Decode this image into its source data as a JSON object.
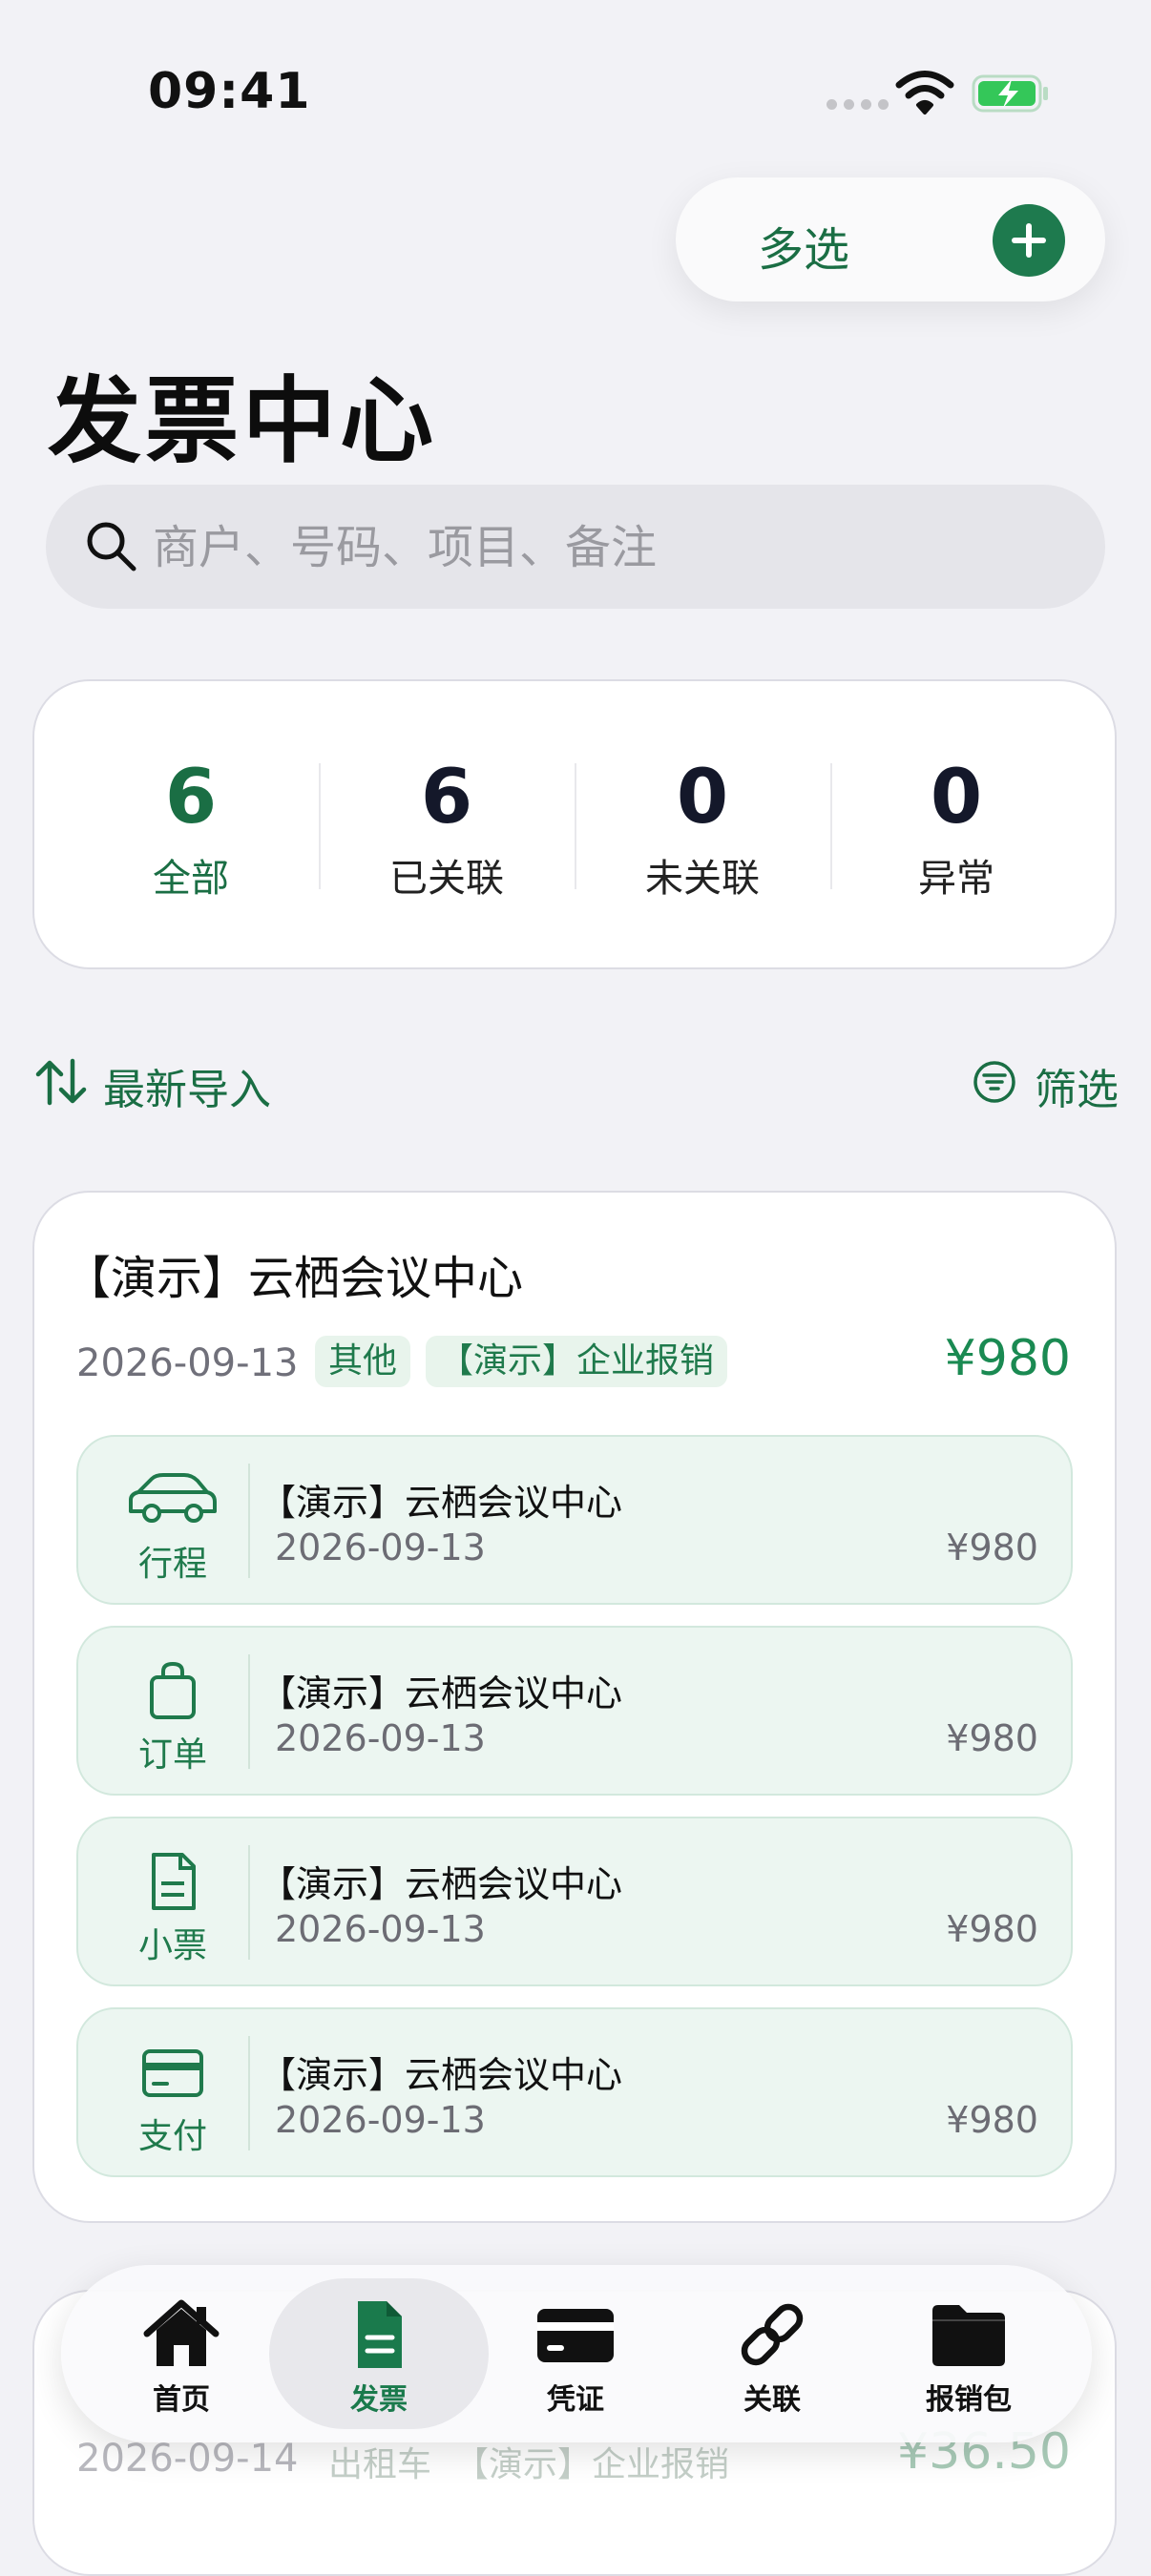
{
  "status_bar": {
    "time": "09:41"
  },
  "header": {
    "multi_select_label": "多选",
    "title": "发票中心"
  },
  "search": {
    "placeholder": "商户、号码、项目、备注"
  },
  "stats": [
    {
      "count": "6",
      "label": "全部",
      "active": true
    },
    {
      "count": "6",
      "label": "已关联",
      "active": false
    },
    {
      "count": "0",
      "label": "未关联",
      "active": false
    },
    {
      "count": "0",
      "label": "异常",
      "active": false
    }
  ],
  "toolbar": {
    "sort_label": "最新导入",
    "filter_label": "筛选"
  },
  "invoice": {
    "title": "【演示】云栖会议中心",
    "date": "2026-09-13",
    "tags": [
      "其他",
      "【演示】企业报销"
    ],
    "amount": "¥980",
    "items": [
      {
        "kind": "行程",
        "icon": "car-icon",
        "name": "【演示】云栖会议中心",
        "date": "2026-09-13",
        "amount": "¥980"
      },
      {
        "kind": "订单",
        "icon": "shopping-bag-icon",
        "name": "【演示】云栖会议中心",
        "date": "2026-09-13",
        "amount": "¥980"
      },
      {
        "kind": "小票",
        "icon": "receipt-icon",
        "name": "【演示】云栖会议中心",
        "date": "2026-09-13",
        "amount": "¥980"
      },
      {
        "kind": "支付",
        "icon": "credit-card-icon",
        "name": "【演示】云栖会议中心",
        "date": "2026-09-13",
        "amount": "¥980"
      }
    ]
  },
  "next_invoice": {
    "date": "2026-09-14",
    "tags": [
      "出租车",
      "【演示】企业报销"
    ],
    "amount": "¥36.50"
  },
  "tabs": [
    {
      "label": "首页",
      "icon": "home-icon",
      "active": false
    },
    {
      "label": "发票",
      "icon": "invoice-icon",
      "active": true
    },
    {
      "label": "凭证",
      "icon": "card-icon",
      "active": false
    },
    {
      "label": "关联",
      "icon": "link-icon",
      "active": false
    },
    {
      "label": "报销包",
      "icon": "folder-icon",
      "active": false
    }
  ],
  "colors": {
    "accent": "#1a6e44",
    "accent_bg": "#ecf6f1",
    "background": "#f2f2f6"
  }
}
